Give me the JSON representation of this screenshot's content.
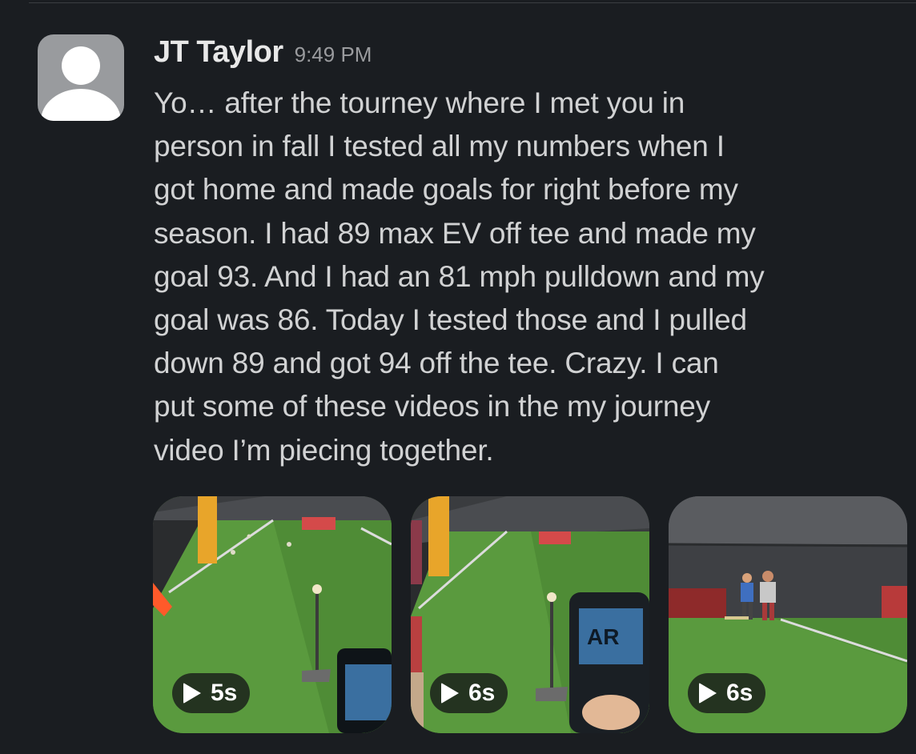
{
  "message": {
    "author": "JT Taylor",
    "time": "9:49 PM",
    "lines": [
      "Yo… after the tourney where I met you in",
      "person in fall I tested all my numbers when I",
      "got home and made goals for right before my",
      "season. I had 89 max EV off tee and made my",
      "goal 93. And I had an 81 mph pulldown and my",
      "goal was 86. Today I tested those and I pulled",
      "down 89 and got 94 off the tee. Crazy. I can",
      "put some of these videos in the my journey",
      "video I’m piecing together."
    ]
  },
  "avatar": {
    "icon": "user-silhouette-icon",
    "background": "#999b9e"
  },
  "videos": [
    {
      "duration": "5s",
      "icon": "play-icon"
    },
    {
      "duration": "6s",
      "icon": "play-icon"
    },
    {
      "duration": "6s",
      "icon": "play-icon"
    }
  ],
  "colors": {
    "background": "#1a1d21",
    "text": "#d1d2d3",
    "author": "#e8e8e8",
    "timestamp": "#9a9b9e"
  }
}
